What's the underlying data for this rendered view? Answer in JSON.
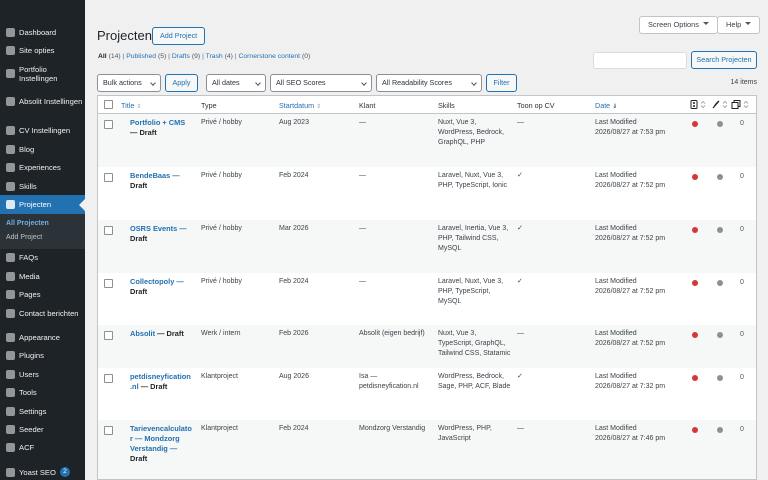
{
  "sidebar": {
    "items": [
      {
        "label": "Dashboard",
        "icon": "dashboard-icon"
      },
      {
        "label": "Site opties",
        "icon": "gear-icon"
      },
      {
        "label": "Portfolio Instellingen",
        "icon": "gear-icon"
      },
      {
        "label": "Absolit Instellingen",
        "icon": "gear-icon"
      },
      {
        "label": "CV Instellingen",
        "icon": "gear-icon"
      },
      {
        "label": "Blog",
        "icon": "pin-icon"
      },
      {
        "label": "Experiences",
        "icon": "pin-icon"
      },
      {
        "label": "Skills",
        "icon": "pin-icon"
      },
      {
        "label": "Projecten",
        "icon": "pin-icon"
      },
      {
        "label": "FAQs",
        "icon": "pin-icon"
      },
      {
        "label": "Media",
        "icon": "media-icon"
      },
      {
        "label": "Pages",
        "icon": "pages-icon"
      },
      {
        "label": "Contact berichten",
        "icon": "pin-icon"
      },
      {
        "label": "Appearance",
        "icon": "brush-icon"
      },
      {
        "label": "Plugins",
        "icon": "plugin-icon"
      },
      {
        "label": "Users",
        "icon": "users-icon"
      },
      {
        "label": "Tools",
        "icon": "tools-icon"
      },
      {
        "label": "Settings",
        "icon": "settings-icon"
      },
      {
        "label": "Seeder",
        "icon": "gear-icon"
      },
      {
        "label": "ACF",
        "icon": "grid-icon"
      },
      {
        "label": "Yoast SEO",
        "icon": "yoast-icon",
        "badge": "2"
      }
    ],
    "submenu": {
      "all": "All Projecten",
      "add": "Add Project"
    }
  },
  "header": {
    "screen_options": "Screen Options",
    "help": "Help",
    "title": "Projecten",
    "add_button": "Add Project"
  },
  "views": {
    "all": "All",
    "all_count": "(14)",
    "published": "Published",
    "published_count": "(5)",
    "drafts": "Drafts",
    "drafts_count": "(9)",
    "trash": "Trash",
    "trash_count": "(4)",
    "cornerstone": "Cornerstone content",
    "cornerstone_count": "(0)",
    "sep": "|"
  },
  "search": {
    "button": "Search Projecten"
  },
  "filters": {
    "bulk": "Bulk actions",
    "apply": "Apply",
    "dates": "All dates",
    "seo": "All SEO Scores",
    "readability": "All Readability Scores",
    "filter": "Filter",
    "items_count": "14 items"
  },
  "columns": {
    "title": "Title",
    "type": "Type",
    "start": "Startdatum",
    "client": "Klant",
    "skills": "Skills",
    "cv": "Toon op CV",
    "date": "Date"
  },
  "rows": [
    {
      "title1": "Portfolio + CMS",
      "title2": "",
      "state": "— Draft",
      "type": "Privé / hobby",
      "start": "Aug 2023",
      "client1": "—",
      "client2": "",
      "skills1": "Nuxt, Vue 3,",
      "skills2": "WordPress, Bedrock,",
      "skills3": "GraphQL, PHP",
      "cv": "—",
      "date1": "Last Modified",
      "date2": "2026/08/27 at 7:53 pm",
      "links": "0"
    },
    {
      "title1": "BendeBaas —",
      "title2": "",
      "state": "Draft",
      "type": "Privé / hobby",
      "start": "Feb 2024",
      "client1": "—",
      "client2": "",
      "skills1": "Laravel, Nuxt, Vue 3,",
      "skills2": "PHP, TypeScript, Ionic",
      "skills3": "",
      "cv": "✓",
      "date1": "Last Modified",
      "date2": "2026/08/27 at 7:52 pm",
      "links": "0"
    },
    {
      "title1": "OSRS Events —",
      "title2": "",
      "state": "Draft",
      "type": "Privé / hobby",
      "start": "Mar 2026",
      "client1": "—",
      "client2": "",
      "skills1": "Laravel, Inertia, Vue 3,",
      "skills2": "PHP, Tailwind CSS,",
      "skills3": "MySQL",
      "cv": "✓",
      "date1": "Last Modified",
      "date2": "2026/08/27 at 7:52 pm",
      "links": "0"
    },
    {
      "title1": "Collectopoly —",
      "title2": "",
      "state": "Draft",
      "type": "Privé / hobby",
      "start": "Feb 2024",
      "client1": "—",
      "client2": "",
      "skills1": "Laravel, Nuxt, Vue 3,",
      "skills2": "PHP, TypeScript,",
      "skills3": "MySQL",
      "cv": "✓",
      "date1": "Last Modified",
      "date2": "2026/08/27 at 7:52 pm",
      "links": "0"
    },
    {
      "title1": "Absolit",
      "title2": "",
      "state": "— Draft",
      "type": "Werk / intern",
      "start": "Feb 2026",
      "client1": "Absolit (eigen bedrijf)",
      "client2": "",
      "skills1": "Nuxt, Vue 3,",
      "skills2": "TypeScript, GraphQL,",
      "skills3": "Tailwind CSS, Statamic",
      "cv": "—",
      "date1": "Last Modified",
      "date2": "2026/08/27 at 7:52 pm",
      "links": "0"
    },
    {
      "title1": "petdisneyfication",
      "title2": ".nl",
      "state": "— Draft",
      "type": "Klantproject",
      "start": "Aug 2026",
      "client1": "Isa —",
      "client2": "petdisneyfication.nl",
      "skills1": "WordPress, Bedrock,",
      "skills2": "Sage, PHP, ACF, Blade",
      "skills3": "",
      "cv": "✓",
      "date1": "Last Modified",
      "date2": "2026/08/27 at 7:32 pm",
      "links": "0"
    },
    {
      "title1": "Tarievencalculato",
      "title2": "r — Mondzorg",
      "title3": "Verstandig —",
      "state": "Draft",
      "type": "Klantproject",
      "start": "Feb 2024",
      "client1": "Mondzorg Verstandig",
      "client2": "",
      "skills1": "WordPress, PHP,",
      "skills2": "JavaScript",
      "skills3": "",
      "cv": "—",
      "date1": "Last Modified",
      "date2": "2026/08/27 at 7:46 pm",
      "links": "0"
    }
  ],
  "colors": {
    "accent": "#2271b1",
    "sidebar_bg": "#1d2327",
    "seo_bad": "#d63638",
    "neutral": "#8c8f94"
  }
}
